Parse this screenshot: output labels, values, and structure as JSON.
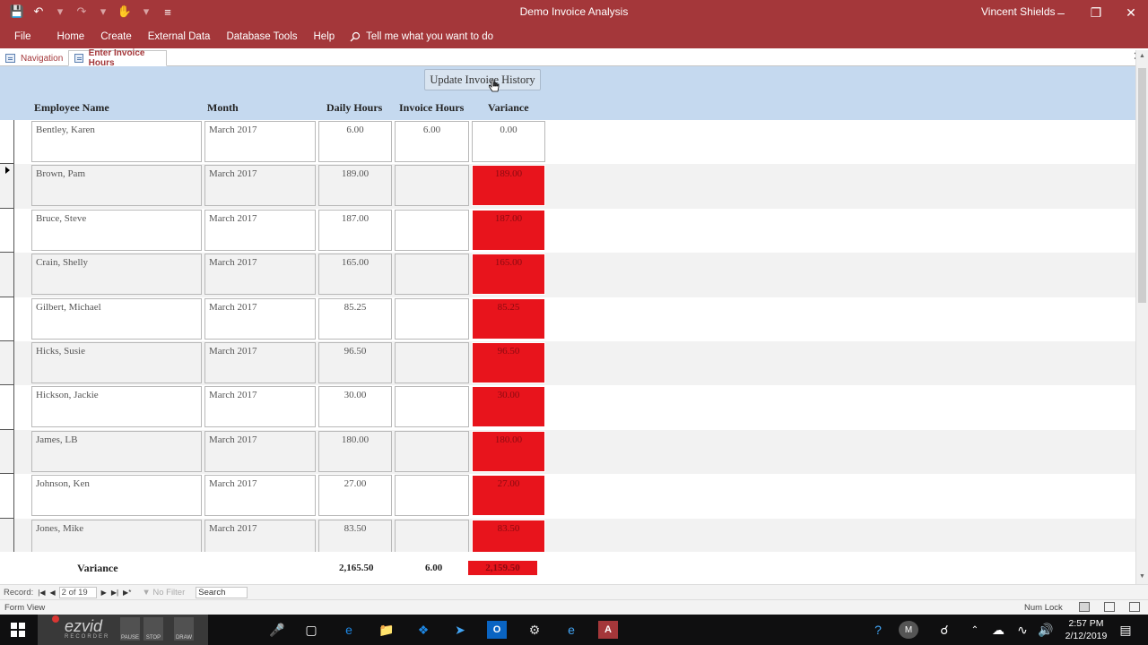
{
  "window": {
    "title": "Demo Invoice Analysis",
    "user": "Vincent Shields"
  },
  "ribbon": {
    "tabs": [
      "File",
      "Home",
      "Create",
      "External Data",
      "Database Tools",
      "Help"
    ],
    "tell_me": "Tell me what you want to do"
  },
  "doc_tabs": {
    "navigation": "Navigation",
    "active": "Enter Invoice Hours"
  },
  "form": {
    "update_button": "Update Invoice History",
    "columns": {
      "name": "Employee Name",
      "month": "Month",
      "daily": "Daily Hours",
      "invoice": "Invoice Hours",
      "variance": "Variance"
    },
    "rows": [
      {
        "name": "Bentley, Karen",
        "month": "March 2017",
        "daily": "6.00",
        "invoice": "6.00",
        "variance": "0.00",
        "flag": false
      },
      {
        "name": "Brown, Pam",
        "month": "March 2017",
        "daily": "189.00",
        "invoice": "",
        "variance": "189.00",
        "flag": true
      },
      {
        "name": "Bruce, Steve",
        "month": "March 2017",
        "daily": "187.00",
        "invoice": "",
        "variance": "187.00",
        "flag": true
      },
      {
        "name": "Crain, Shelly",
        "month": "March 2017",
        "daily": "165.00",
        "invoice": "",
        "variance": "165.00",
        "flag": true
      },
      {
        "name": "Gilbert, Michael",
        "month": "March 2017",
        "daily": "85.25",
        "invoice": "",
        "variance": "85.25",
        "flag": true
      },
      {
        "name": "Hicks, Susie",
        "month": "March 2017",
        "daily": "96.50",
        "invoice": "",
        "variance": "96.50",
        "flag": true
      },
      {
        "name": "Hickson, Jackie",
        "month": "March 2017",
        "daily": "30.00",
        "invoice": "",
        "variance": "30.00",
        "flag": true
      },
      {
        "name": "James, LB",
        "month": "March 2017",
        "daily": "180.00",
        "invoice": "",
        "variance": "180.00",
        "flag": true
      },
      {
        "name": "Johnson, Ken",
        "month": "March 2017",
        "daily": "27.00",
        "invoice": "",
        "variance": "27.00",
        "flag": true
      },
      {
        "name": "Jones, Mike",
        "month": "March 2017",
        "daily": "83.50",
        "invoice": "",
        "variance": "83.50",
        "flag": true
      }
    ],
    "current_row": 1,
    "footer": {
      "label": "Variance",
      "daily_total": "2,165.50",
      "invoice_total": "6.00",
      "variance_total": "2,159.50"
    }
  },
  "record_nav": {
    "label": "Record:",
    "current": "2 of 19",
    "filter": "No Filter",
    "search": "Search"
  },
  "status": {
    "view": "Form View",
    "num_lock": "Num Lock"
  },
  "recorder": {
    "logo": "ezvid",
    "sub": "RECORDER",
    "pause": "PAUSE",
    "stop": "STOP",
    "draw": "DRAW"
  },
  "clock": {
    "time": "2:57 PM",
    "date": "2/12/2019"
  },
  "colors": {
    "access_red": "#a4373a",
    "header_blue": "#c5d9ef",
    "variance_red": "#e8141c"
  }
}
